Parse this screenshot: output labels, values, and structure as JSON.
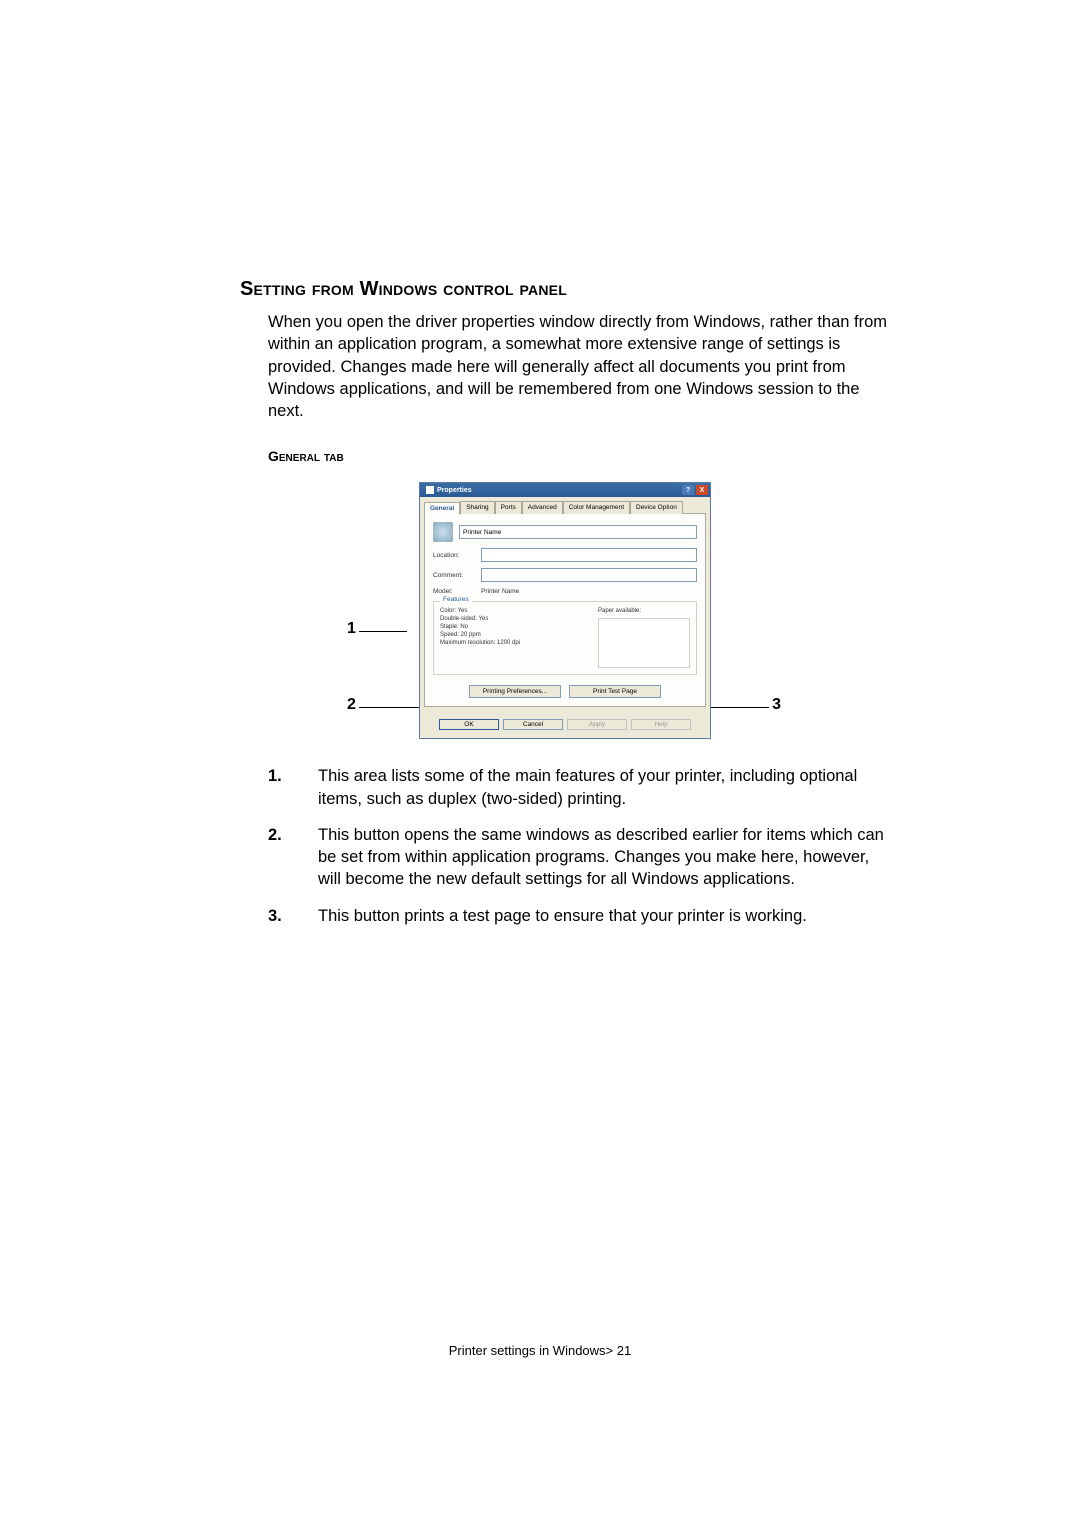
{
  "heading": "Setting from Windows control panel",
  "intro": "When you open the driver properties window directly from Windows, rather than from within an application program, a somewhat more extensive range of settings is provided. Changes made here will generally affect all documents you print from Windows applications, and will be remembered from one Windows session to the next.",
  "subheading": "General tab",
  "dialog": {
    "title": "Properties",
    "help_btn": "?",
    "close_btn": "X",
    "tabs": [
      "General",
      "Sharing",
      "Ports",
      "Advanced",
      "Color Management",
      "Device Option"
    ],
    "printer_name_field": "Printer Name",
    "location_label": "Location:",
    "comment_label": "Comment:",
    "model_label": "Model:",
    "model_value": "Printer Name",
    "features_label": "Features",
    "features": {
      "color": "Color: Yes",
      "double_sided": "Double-sided: Yes",
      "staple": "Staple: No",
      "speed": "Speed: 20 ppm",
      "max_res": "Maximum resolution: 1200 dpi",
      "paper_header": "Paper available:"
    },
    "printing_prefs_btn": "Printing Preferences...",
    "print_test_btn": "Print Test Page",
    "ok_btn": "OK",
    "cancel_btn": "Cancel",
    "apply_btn": "Apply",
    "help_btn2": "Help"
  },
  "callouts": {
    "c1": "1",
    "c2": "2",
    "c3": "3"
  },
  "list": {
    "n1": "1.",
    "t1": "This area lists some of the main features of your printer, including optional items, such as duplex (two-sided) printing.",
    "n2": "2.",
    "t2": "This button opens the same windows as described earlier for items which can be set from within application programs. Changes you make here, however, will become the new default settings for all Windows applications.",
    "n3": "3.",
    "t3": "This button prints a test page to ensure that your printer is working."
  },
  "footer": "Printer settings in Windows> 21"
}
